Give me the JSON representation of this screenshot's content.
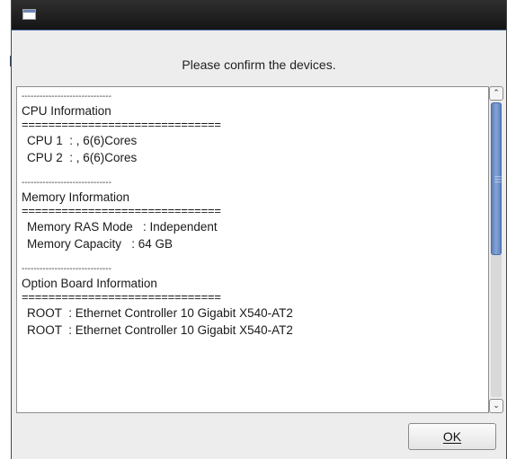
{
  "dialog": {
    "heading": "Please confirm the devices.",
    "ok_label": "OK"
  },
  "content": {
    "sections": [
      {
        "separator_top": "------------------------------",
        "title": "CPU Information",
        "separator_bottom": "==============================",
        "items": [
          "CPU 1  : , 6(6)Cores",
          "CPU 2  : , 6(6)Cores"
        ]
      },
      {
        "separator_top": "------------------------------",
        "title": "Memory Information",
        "separator_bottom": "==============================",
        "items": [
          "Memory RAS Mode   : Independent",
          "Memory Capacity   : 64 GB"
        ]
      },
      {
        "separator_top": "------------------------------",
        "title": "Option Board Information",
        "separator_bottom": "==============================",
        "items": [
          "ROOT  : Ethernet Controller 10 Gigabit X540-AT2",
          "ROOT  : Ethernet Controller 10 Gigabit X540-AT2"
        ]
      }
    ]
  },
  "icons": {
    "window_icon": "window-icon",
    "scroll_up": "chevron-up-icon",
    "scroll_down": "chevron-down-icon"
  },
  "colors": {
    "titlebar": "#1f1f1f",
    "scroll_thumb": "#6f8fc8",
    "dialog_bg": "#ededed"
  }
}
